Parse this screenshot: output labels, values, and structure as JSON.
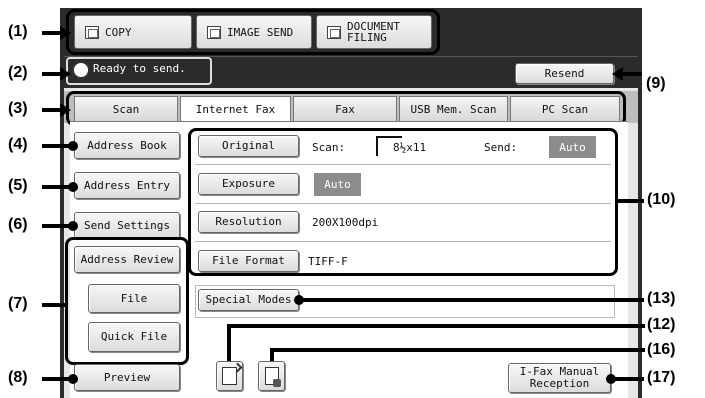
{
  "callouts": {
    "c1": "(1)",
    "c2": "(2)",
    "c3": "(3)",
    "c4": "(4)",
    "c5": "(5)",
    "c6": "(6)",
    "c7": "(7)",
    "c8": "(8)",
    "c9": "(9)",
    "c10": "(10)",
    "c12": "(12)",
    "c13": "(13)",
    "c16": "(16)",
    "c17": "(17)"
  },
  "mode_tabs": {
    "copy": "COPY",
    "image_send": "IMAGE SEND",
    "doc_filing_1": "DOCUMENT",
    "doc_filing_2": "FILING"
  },
  "status": {
    "message": "Ready to send."
  },
  "resend_label": "Resend",
  "send_tabs": [
    "Scan",
    "Internet Fax",
    "Fax",
    "USB Mem. Scan",
    "PC Scan"
  ],
  "active_tab": "Internet Fax",
  "left_buttons": {
    "address_book": "Address Book",
    "address_entry": "Address Entry",
    "send_settings": "Send Settings",
    "address_review": "Address Review",
    "file": "File",
    "quick_file": "Quick File",
    "preview": "Preview"
  },
  "settings": {
    "original_label": "Original",
    "scan_label": "Scan:",
    "scan_size": "8½x11",
    "send_label": "Send:",
    "send_value": "Auto",
    "exposure_label": "Exposure",
    "exposure_value": "Auto",
    "resolution_label": "Resolution",
    "resolution_value": "200X100dpi",
    "file_format_label": "File Format",
    "file_format_value": "TIFF-F"
  },
  "special_modes_label": "Special Modes",
  "manual_reception": {
    "line1": "I-Fax Manual",
    "line2": "Reception"
  },
  "colors": {
    "frame": "#2b2b2b",
    "panel": "#e6e6e6",
    "auto_badge": "#8c8c8c"
  },
  "icons": [
    "copy-icon",
    "image-send-icon",
    "document-filing-icon",
    "status-icon",
    "program-icon",
    "job-icon"
  ]
}
